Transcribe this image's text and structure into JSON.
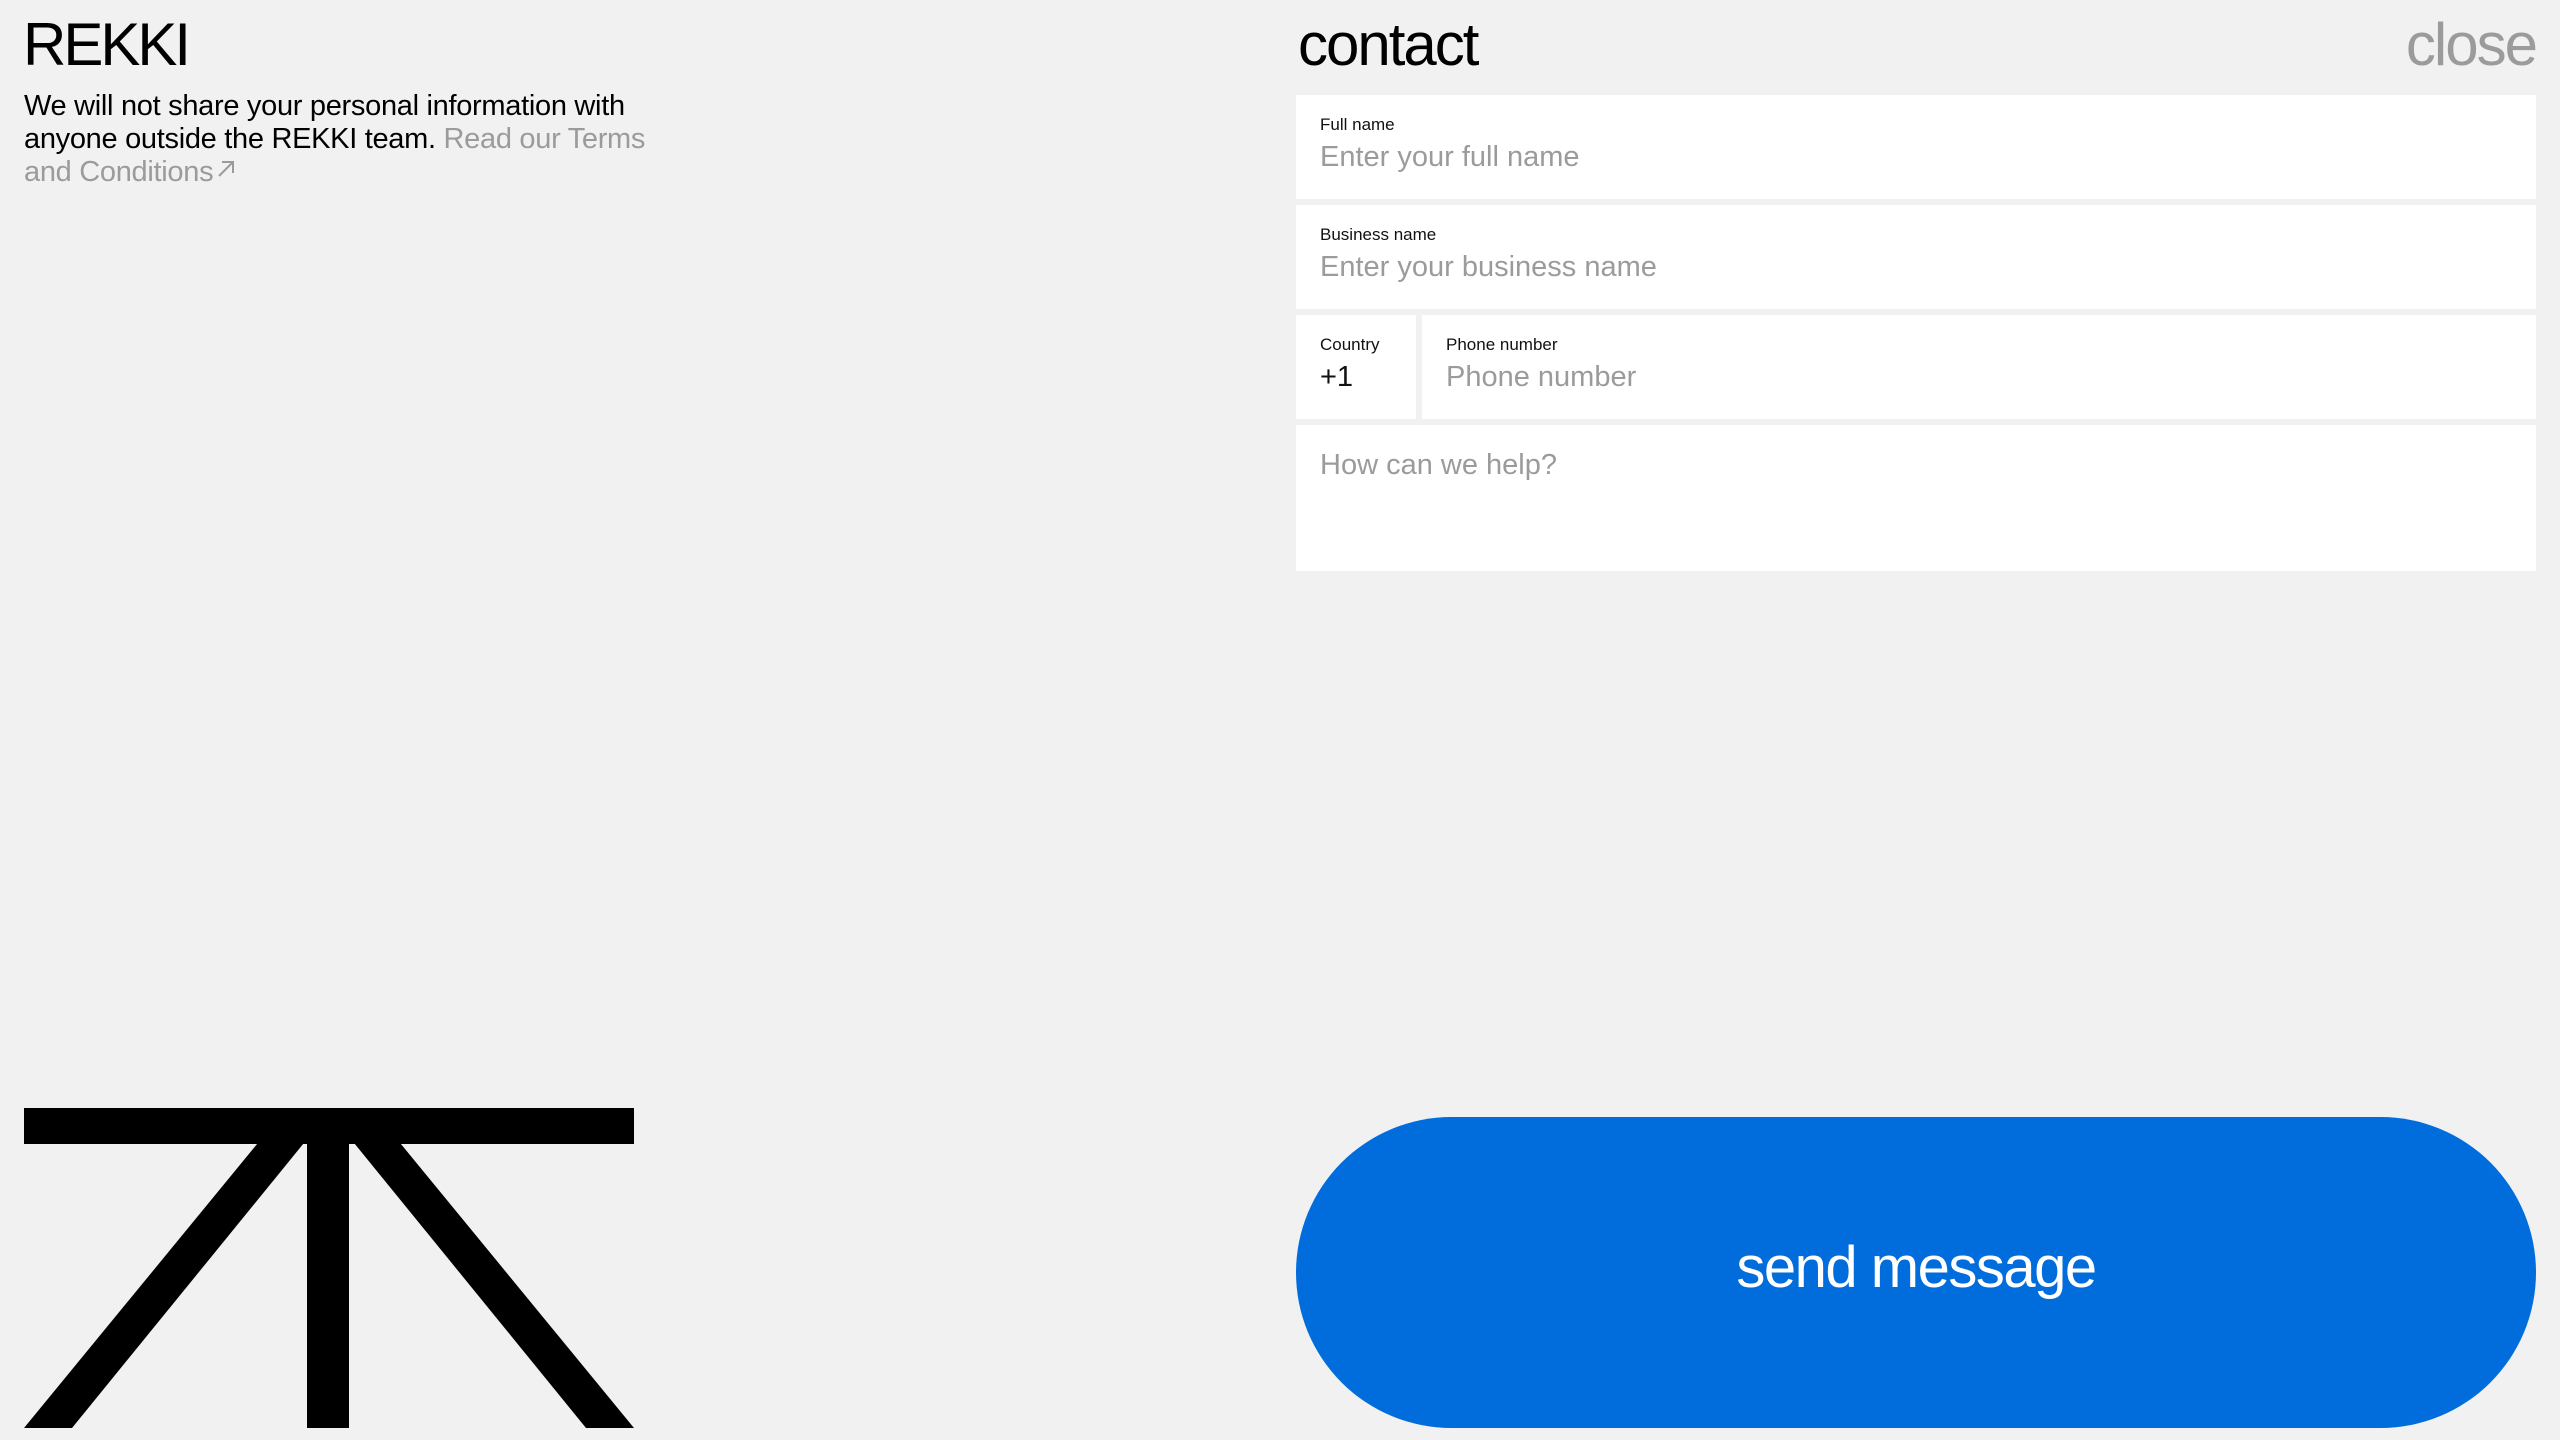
{
  "brand": {
    "logo": "REKKI"
  },
  "privacy": {
    "text": "We will not share your personal information with anyone outside the REKKI team.",
    "link_text": "Read our Terms and Conditions"
  },
  "header": {
    "title": "contact",
    "close_label": "close"
  },
  "form": {
    "full_name": {
      "label": "Full name",
      "placeholder": "Enter your full name"
    },
    "business_name": {
      "label": "Business name",
      "placeholder": "Enter your business name"
    },
    "country": {
      "label": "Country",
      "value": "+1"
    },
    "phone": {
      "label": "Phone number",
      "placeholder": "Phone number"
    },
    "help": {
      "placeholder": "How can we help?"
    }
  },
  "actions": {
    "send_label": "send message"
  },
  "colors": {
    "accent": "#016ddc",
    "background": "#f1f1f1",
    "muted": "#9b9b9b"
  },
  "icons": {
    "link_arrow": "arrow-up-right-icon",
    "brand_mark": "rekki-mark-icon"
  }
}
